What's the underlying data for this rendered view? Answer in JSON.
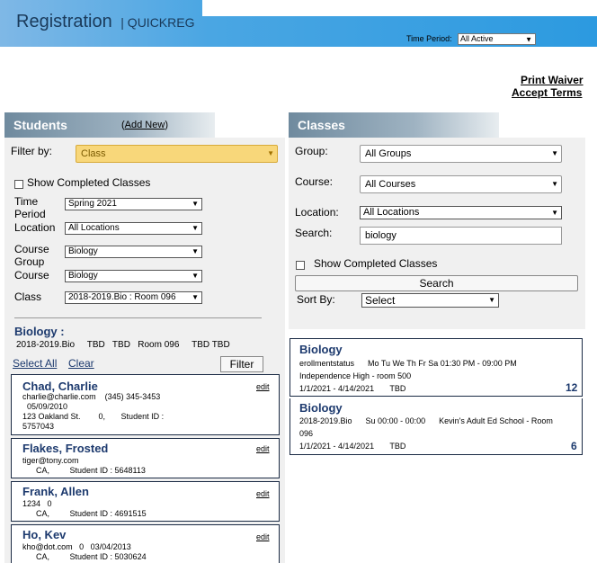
{
  "header": {
    "title": "Registration",
    "subtitle": "| QUICKREG",
    "time_period_label": "Time Period:",
    "time_period_value": "All Active"
  },
  "links": {
    "print_waiver": "Print Waiver",
    "accept_terms": "Accept Terms"
  },
  "students": {
    "title": "Students",
    "add_new_open": "(",
    "add_new": "Add New",
    "add_new_close": ")",
    "filter_by_label": "Filter by:",
    "filter_by_value": "Class",
    "show_completed": "Show Completed Classes",
    "time_period_label": "Time Period",
    "time_period_value": "Spring 2021",
    "location_label": "Location",
    "location_value": "All Locations",
    "course_group_label": "Course Group",
    "course_group_value": "Biology",
    "course_label": "Course",
    "course_value": "Biology",
    "class_label": "Class",
    "class_value": "2018-2019.Bio : Room 096",
    "selected_class_title": "Biology :",
    "selected_class_detail": "2018-2019.Bio     TBD   TBD   Room 096     TBD TBD",
    "select_all": "Select All",
    "clear": "Clear",
    "filter_button": "Filter",
    "list": [
      {
        "name": "Chad, Charlie",
        "edit": "edit",
        "line1": "charlie@charlie.com    (345) 345-3453",
        "line2": "  05/09/2010",
        "line3": "123 Oakland St.        0,       Student ID :",
        "line4": "5757043"
      },
      {
        "name": "Flakes, Frosted",
        "edit": "edit",
        "line1": "tiger@tony.com",
        "line2": "      CA,         Student ID : 5648113"
      },
      {
        "name": "Frank, Allen",
        "edit": "edit",
        "line1": "1234   0",
        "line2": "      CA,         Student ID : 4691515"
      },
      {
        "name": "Ho, Kev",
        "edit": "edit",
        "line1": "kho@dot.com   0   03/04/2013",
        "line2": "      CA,         Student ID : 5030624"
      }
    ]
  },
  "classes": {
    "title": "Classes",
    "group_label": "Group:",
    "group_value": "All Groups",
    "course_label": "Course:",
    "course_value": "All Courses",
    "location_label": "Location:",
    "location_value": "All Locations",
    "search_label": "Search:",
    "search_value": "biology",
    "show_completed": "Show Completed Classes",
    "search_button": "Search",
    "sort_by_label": "Sort By:",
    "sort_by_value": "Select",
    "list": [
      {
        "title": "Biology",
        "line1": "erollmentstatus      Mo Tu We Th Fr Sa 01:30 PM - 09:00 PM",
        "line2": "Independence High - room 500",
        "dates": "1/1/2021 - 4/14/2021       TBD",
        "count": "12"
      },
      {
        "title": "Biology",
        "line1": "2018-2019.Bio      Su 00:00 - 00:00      Kevin's Adult Ed School - Room",
        "line2": "096",
        "dates": "1/1/2021 - 4/14/2021       TBD",
        "count": "6"
      }
    ]
  }
}
